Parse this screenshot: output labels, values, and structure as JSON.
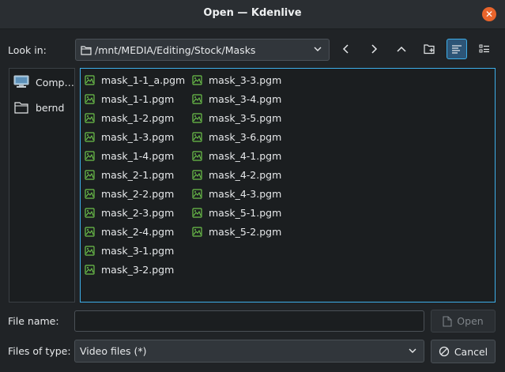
{
  "window": {
    "title": "Open — Kdenlive",
    "close_icon": "close-icon"
  },
  "colors": {
    "accent": "#3daee9",
    "close": "#e9642b",
    "image_icon": "#6cc24a"
  },
  "location": {
    "label": "Look in:",
    "path": "/mnt/MEDIA/Editing/Stock/Masks"
  },
  "toolbar": {
    "back_icon": "chevron-left-icon",
    "forward_icon": "chevron-right-icon",
    "parent_icon": "chevron-up-icon",
    "new_folder_icon": "new-folder-icon",
    "detail_view_icon": "detail-view-icon",
    "detail_view_active": true,
    "list_view_icon": "list-view-icon"
  },
  "places": [
    {
      "label": "Comp…",
      "icon": "computer-icon"
    },
    {
      "label": "bernd",
      "icon": "folder-icon"
    }
  ],
  "files_col1": [
    "mask_1-1_a.pgm",
    "mask_1-1.pgm",
    "mask_1-2.pgm",
    "mask_1-3.pgm",
    "mask_1-4.pgm",
    "mask_2-1.pgm",
    "mask_2-2.pgm",
    "mask_2-3.pgm",
    "mask_2-4.pgm",
    "mask_3-1.pgm",
    "mask_3-2.pgm"
  ],
  "files_col2": [
    "mask_3-3.pgm",
    "mask_3-4.pgm",
    "mask_3-5.pgm",
    "mask_3-6.pgm",
    "mask_4-1.pgm",
    "mask_4-2.pgm",
    "mask_4-3.pgm",
    "mask_5-1.pgm",
    "mask_5-2.pgm"
  ],
  "filename": {
    "label": "File name:",
    "value": ""
  },
  "filetype": {
    "label": "Files of type:",
    "value": "Video files (*)"
  },
  "buttons": {
    "open": "Open",
    "open_enabled": false,
    "cancel": "Cancel"
  }
}
